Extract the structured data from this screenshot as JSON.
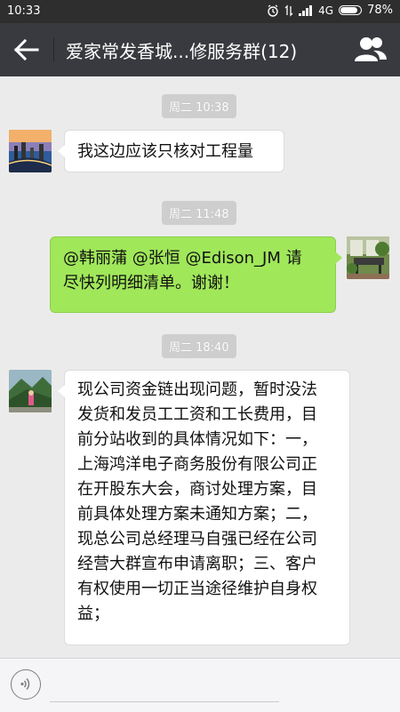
{
  "status_bar": {
    "time": "10:33",
    "network": "4G",
    "battery": "78%"
  },
  "header": {
    "title": "爱家常发香城...修服务群(12)"
  },
  "messages": [
    {
      "timestamp": "周二 10:38",
      "side": "left",
      "text": "我这边应该只核对工程量"
    },
    {
      "timestamp": "周二 11:48",
      "side": "right",
      "text_line1": "@韩丽蒲 @张恒 @Edison_JM 请",
      "text_line2": "尽快列明细清单。谢谢！"
    },
    {
      "timestamp": "周二 18:40",
      "side": "left",
      "lines": [
        "现公司资金链出现问题，暂时没法",
        "发货和发员工工资和工长费用，目",
        "前分站收到的具体情况如下：一，",
        "上海鸿洋电子商务股份有限公司正",
        "在开股东大会，商讨处理方案，目",
        "前具体处理方案未通知方案；二，",
        "现总公司总经理马自强已经在公司",
        "经营大群宣布申请离职；三、客户",
        "有权使用一切正当途径维护自身权",
        "益；"
      ]
    }
  ],
  "colors": {
    "header_bg": "#393a3f",
    "chat_bg": "#ebebeb",
    "own_bubble": "#a0e75a",
    "other_bubble": "#ffffff"
  }
}
